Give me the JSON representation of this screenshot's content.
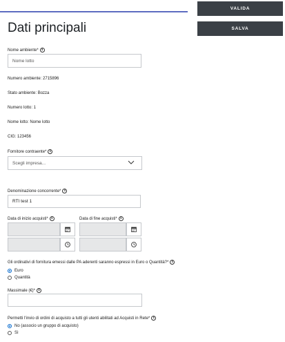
{
  "toolbar": {
    "valida_label": "VALIDA",
    "salva_label": "SALVA"
  },
  "page": {
    "title": "Dati principali"
  },
  "nome_ambiente": {
    "label": "Nome ambiente*",
    "placeholder": "Nome lotto"
  },
  "info": {
    "numero_ambiente": "Numero ambiente: 2715896",
    "stato_ambiente": "Stato ambiente: Bozza",
    "numero_lotto": "Numero lotto: 1",
    "nome_lotto": "Nome lotto: Nome lotto",
    "cig": "CIG: 123456"
  },
  "fornitore": {
    "label": "Fornitore contraente*",
    "placeholder": "Scegli impresa..."
  },
  "denominazione": {
    "label": "Denominazione concorrente*",
    "value": "RTI test 1"
  },
  "data_inizio": {
    "label": "Data di inizio acquisti*"
  },
  "data_fine": {
    "label": "Data di fine acquisti*"
  },
  "valuta": {
    "question": "Gli ordinativi di fornitura emessi dalle PA aderenti saranno espressi in Euro o Quantità?*",
    "options": [
      "Euro",
      "Quantità"
    ],
    "selected": "Euro"
  },
  "massimale": {
    "label": "Massimale (€)*"
  },
  "permessi": {
    "question": "Permetti l'invio di ordini di acquisto a tutti gli utenti abilitati ad Acquisti in Rete*",
    "options": [
      "No (associo un gruppo di acquisto)",
      "Sì"
    ],
    "selected": "No (associo un gruppo di acquisto)"
  },
  "icons": {
    "info": "info-icon",
    "calendar": "calendar-icon",
    "clock": "clock-icon",
    "chevron": "chevron-down-icon"
  },
  "colors": {
    "accent_line": "#5c6bc0",
    "button_bg": "#3b4046",
    "radio_selected": "#0066cc",
    "disabled_field": "#e6e7e8"
  }
}
